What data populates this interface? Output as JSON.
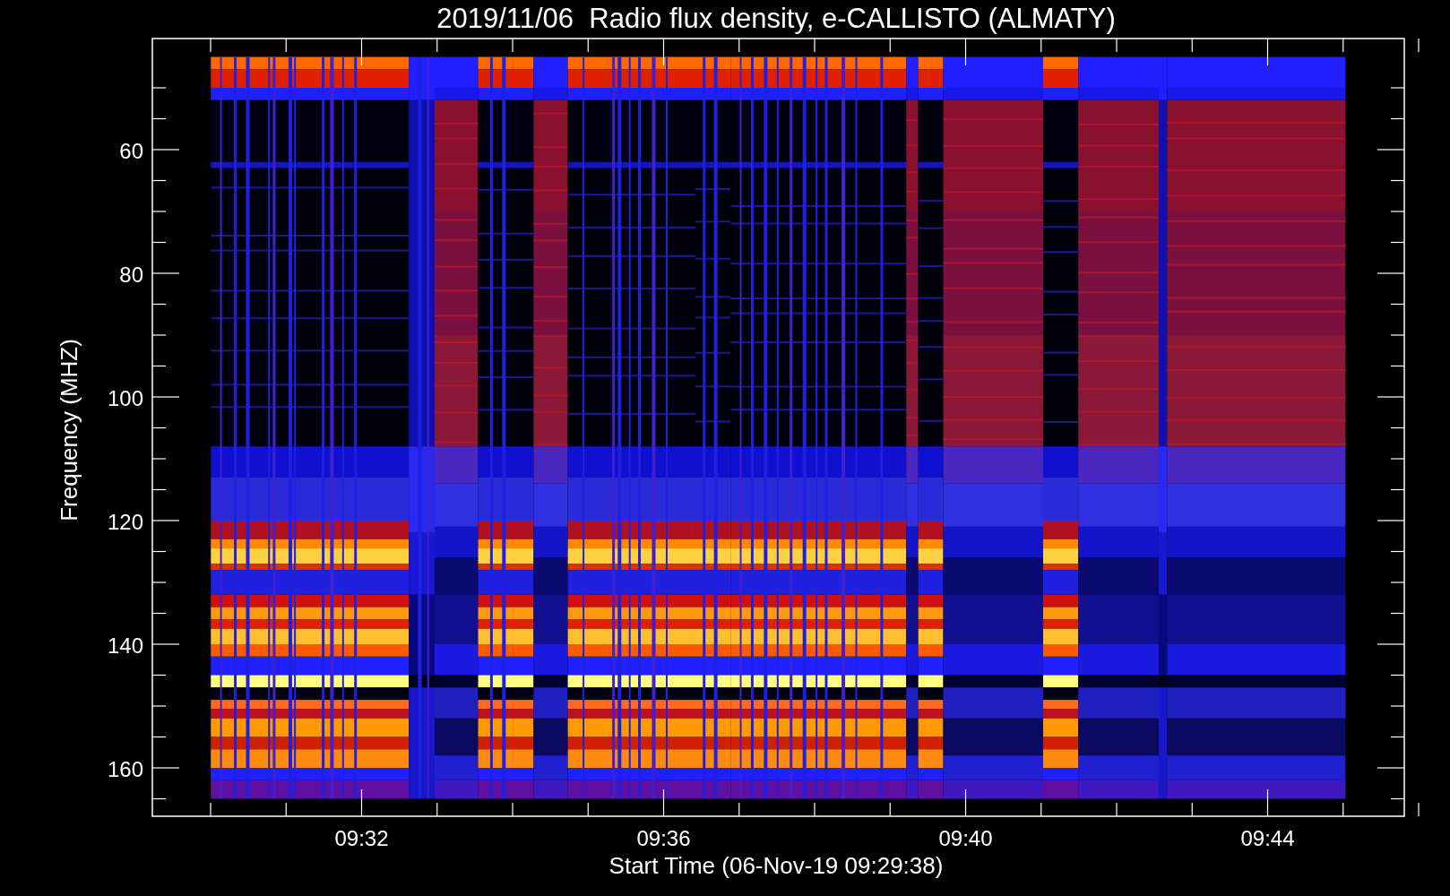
{
  "title": "2019/11/06  Radio flux density, e-CALLISTO (ALMATY)",
  "y_axis": {
    "label": "Frequency (MHZ)",
    "ticks": [
      "60",
      "80",
      "100",
      "120",
      "140",
      "160"
    ]
  },
  "x_axis": {
    "label": "Start Time (06-Nov-19 09:29:38)",
    "ticks": [
      "09:32",
      "09:36",
      "09:40",
      "09:44"
    ]
  }
}
